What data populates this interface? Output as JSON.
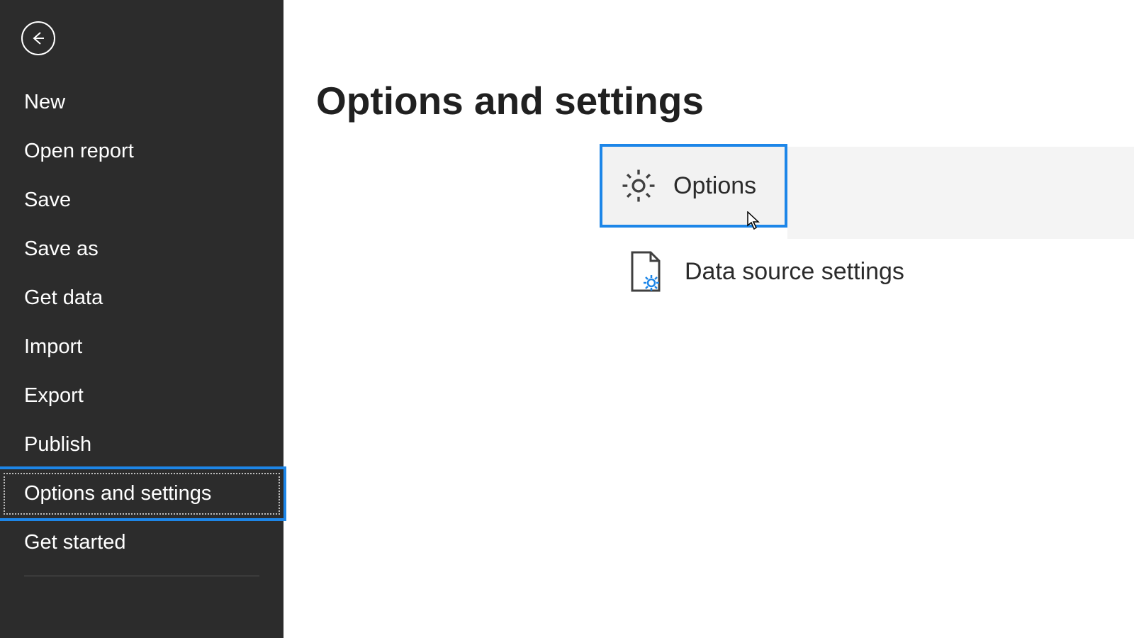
{
  "sidebar": {
    "items": [
      {
        "label": "New"
      },
      {
        "label": "Open report"
      },
      {
        "label": "Save"
      },
      {
        "label": "Save as"
      },
      {
        "label": "Get data"
      },
      {
        "label": "Import"
      },
      {
        "label": "Export"
      },
      {
        "label": "Publish"
      },
      {
        "label": "Options and settings"
      },
      {
        "label": "Get started"
      }
    ]
  },
  "main": {
    "title": "Options and settings",
    "options_label": "Options",
    "data_source_label": "Data source settings"
  }
}
